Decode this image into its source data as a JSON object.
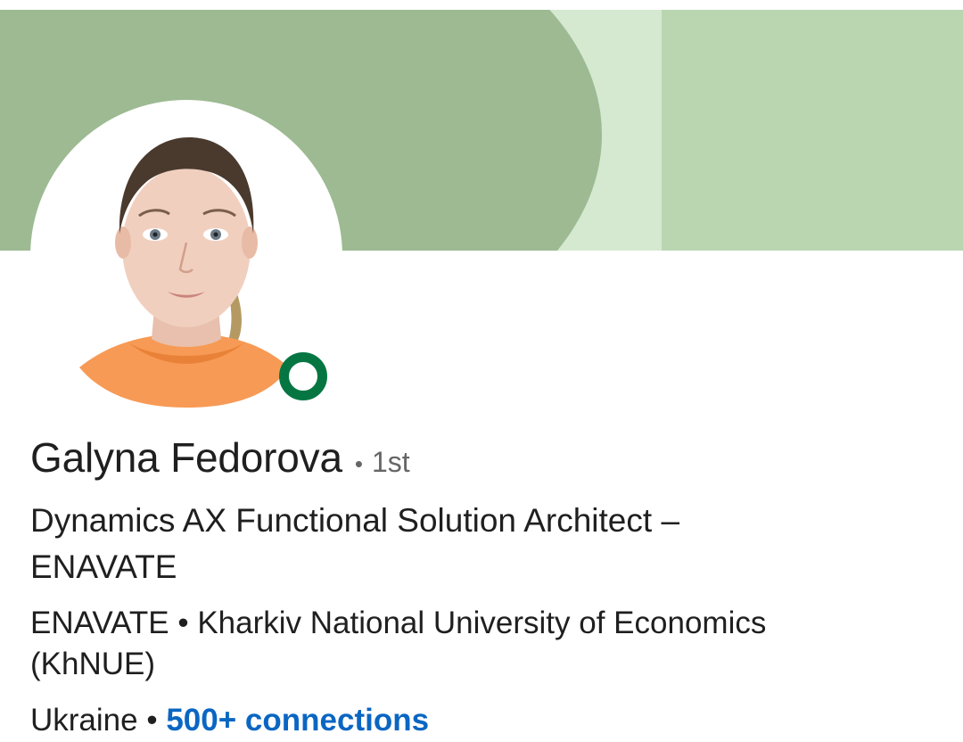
{
  "profile": {
    "name": "Galyna Fedorova",
    "separator": "•",
    "degree": "1st",
    "headline": "Dynamics AX Functional Solution Architect – ENAVATE",
    "company": "ENAVATE",
    "school": "Kharkiv National University of Economics (KhNUE)",
    "location": "Ukraine",
    "connections": "500+ connections",
    "online": true
  },
  "colors": {
    "cover_main": "#9dba92",
    "cover_light": "#b9d6b1",
    "cover_strip": "#d5e9d0",
    "presence": "#057642",
    "link": "#0a66c2",
    "text": "#1f1f1f",
    "muted": "#666666"
  },
  "icons": {
    "presence": "online-status-icon",
    "avatar": "profile-photo"
  }
}
